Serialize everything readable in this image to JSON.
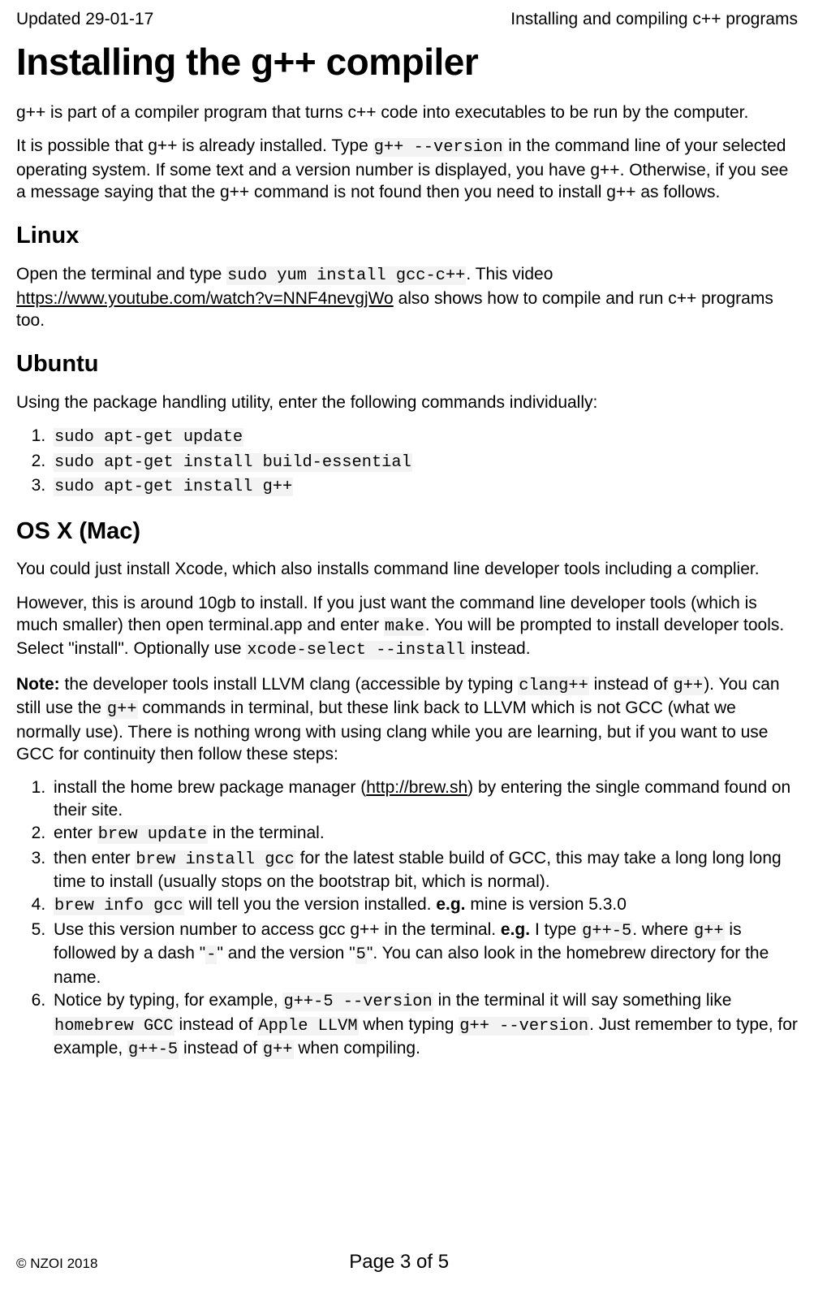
{
  "header": {
    "left": "Updated 29-01-17",
    "right": "Installing and compiling c++ programs"
  },
  "title": "Installing the g++ compiler",
  "intro1": "g++ is part of a compiler program that turns c++ code into executables to be run by the computer.",
  "intro2a": "It is possible that g++ is already installed. Type ",
  "intro2_code": "g++ --version",
  "intro2b": " in the command line of your selected operating system. If some text and a version number is displayed, you have g++. Otherwise, if you see a message saying that the g++ command is not found then you need to install g++ as follows.",
  "linux": {
    "heading": "Linux",
    "p1a": "Open the terminal and type ",
    "p1_code": "sudo yum install gcc-c++",
    "p1b": ". This video ",
    "link": "https://www.youtube.com/watch?v=NNF4nevgjWo",
    "p1c": " also shows how to compile and run c++ programs too."
  },
  "ubuntu": {
    "heading": "Ubuntu",
    "p1": "Using the package handling utility, enter the following commands individually:",
    "cmds": [
      "sudo apt-get update",
      "sudo apt-get install build-essential",
      "sudo apt-get install g++"
    ]
  },
  "osx": {
    "heading": "OS X (Mac)",
    "p1": "You could just install Xcode, which also installs command line developer tools including a complier.",
    "p2a": "However, this is around 10gb to install. If you just want the command line developer tools (which is much smaller) then open terminal.app and enter ",
    "p2_code1": "make",
    "p2b": ". You will be prompted to install developer tools. Select \"install\". Optionally use ",
    "p2_code2": "xcode-select --install",
    "p2c": " instead.",
    "note_label": "Note:",
    "p3a": " the developer tools install LLVM clang (accessible by typing ",
    "p3_code1": "clang++",
    "p3b": " instead of ",
    "p3_code2": "g++",
    "p3c": "). You can still use the ",
    "p3_code3": "g++",
    "p3d": " commands in terminal, but these link back to LLVM which is not GCC (what we normally use). There is nothing wrong with using clang while you are learning, but if you want to use GCC for continuity then follow these steps:",
    "steps": {
      "s1a": "install the home brew package manager (",
      "s1_link": "http://brew.sh",
      "s1b": ") by entering the single command found on their site.",
      "s2a": "enter ",
      "s2_code": "brew update",
      "s2b": " in the terminal.",
      "s3a": "then enter ",
      "s3_code": "brew install gcc",
      "s3b": " for the latest stable build of GCC, this may take a long long long time to install (usually stops on the bootstrap bit, which is normal).",
      "s4_code": "brew info gcc",
      "s4a": " will tell you the version installed. ",
      "s4_eg": "e.g.",
      "s4b": " mine is version 5.3.0",
      "s5a": "Use this version number to access gcc g++ in the terminal. ",
      "s5_eg": "e.g.",
      "s5b": " I type ",
      "s5_code1": "g++-5",
      "s5c": ". where ",
      "s5_code2": "g++",
      "s5d": " is followed by a dash \"",
      "s5_code3": "-",
      "s5e": "\" and the version \"",
      "s5_code4": "5",
      "s5f": "\". You can also look in the homebrew directory for the name.",
      "s6a": "Notice by typing, for example, ",
      "s6_code1": "g++-5 --version",
      "s6b": " in the terminal it will say something like ",
      "s6_code2": "homebrew GCC",
      "s6c": " instead of ",
      "s6_code3": "Apple LLVM",
      "s6d": " when typing ",
      "s6_code4": "g++ --version",
      "s6e": ". Just remember to type, for example, ",
      "s6_code5": "g++-5",
      "s6f": " instead of ",
      "s6_code6": "g++",
      "s6g": " when compiling."
    }
  },
  "footer": {
    "copyright": "© NZOI 2018",
    "page_a": "Page ",
    "page_num": "3",
    "page_b": " of ",
    "page_total": "5"
  }
}
